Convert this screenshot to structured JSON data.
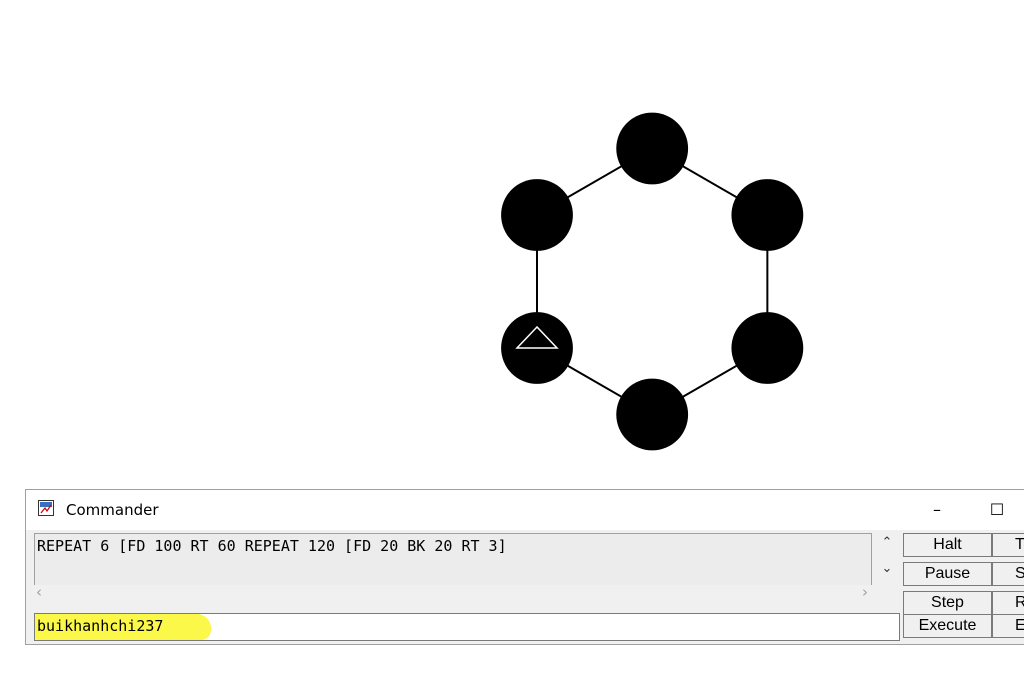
{
  "window": {
    "title": "Commander",
    "minimize_glyph": "–",
    "maximize_glyph": "☐"
  },
  "history": {
    "text": "REPEAT 6 [FD 100 RT 60 REPEAT 120 [FD 20 BK 20 RT 3]"
  },
  "input": {
    "value": "buikhanhchi237",
    "highlight_color": "#fbf84a"
  },
  "buttons": {
    "halt": "Halt",
    "pause": "Pause",
    "step": "Step",
    "execute": "Execute",
    "col2_row1": "T",
    "col2_row2": "S",
    "col2_row3": "R",
    "col2_row4": "E"
  },
  "scroll": {
    "up": "⌃",
    "down": "⌄",
    "left": "‹",
    "right": "›"
  },
  "drawing": {
    "program": "REPEAT 6 [FD 100 RT 60 REPEAT 120 [FD 20 BK 20 RT 3]",
    "sides": 6,
    "side_length": 100,
    "turn_angle": 60,
    "dot_radius": 20,
    "ink_color": "#000000",
    "background_color": "#ffffff",
    "turtle_icon": "triangle-turtle-icon"
  }
}
